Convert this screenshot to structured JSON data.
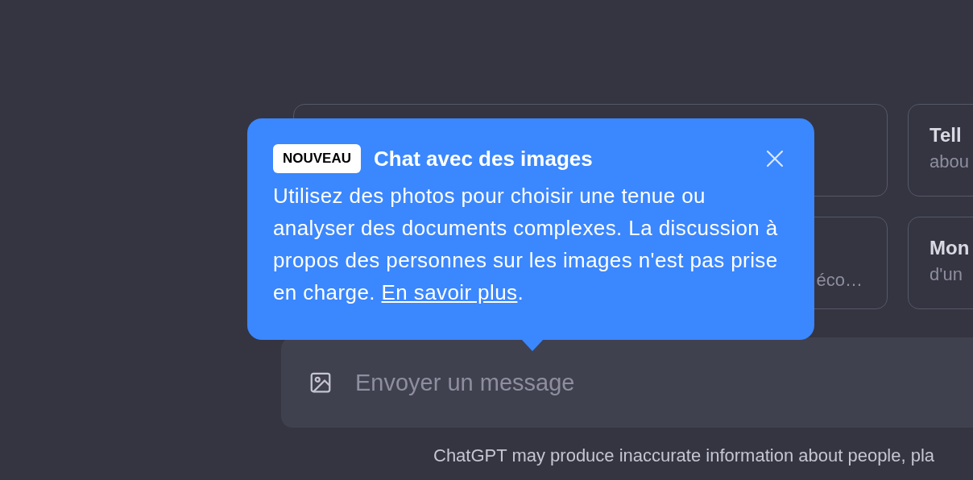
{
  "suggestions": [
    {
      "kind": "blank"
    },
    {
      "title": "Tell",
      "subtitle": "abou"
    },
    {
      "subtitle": "éco…"
    },
    {
      "title": "Mon",
      "subtitle": "d'un"
    }
  ],
  "composer": {
    "placeholder": "Envoyer un message"
  },
  "footer": "ChatGPT may produce inaccurate information about people, pla",
  "popover": {
    "badge": "NOUVEAU",
    "title": "Chat avec des images",
    "body": "Utilisez des photos pour choisir une tenue ou analyser des documents complexes. La discussion à propos des personnes sur les images n'est pas prise en charge. ",
    "link": "En savoir plus",
    "after_link": "."
  }
}
